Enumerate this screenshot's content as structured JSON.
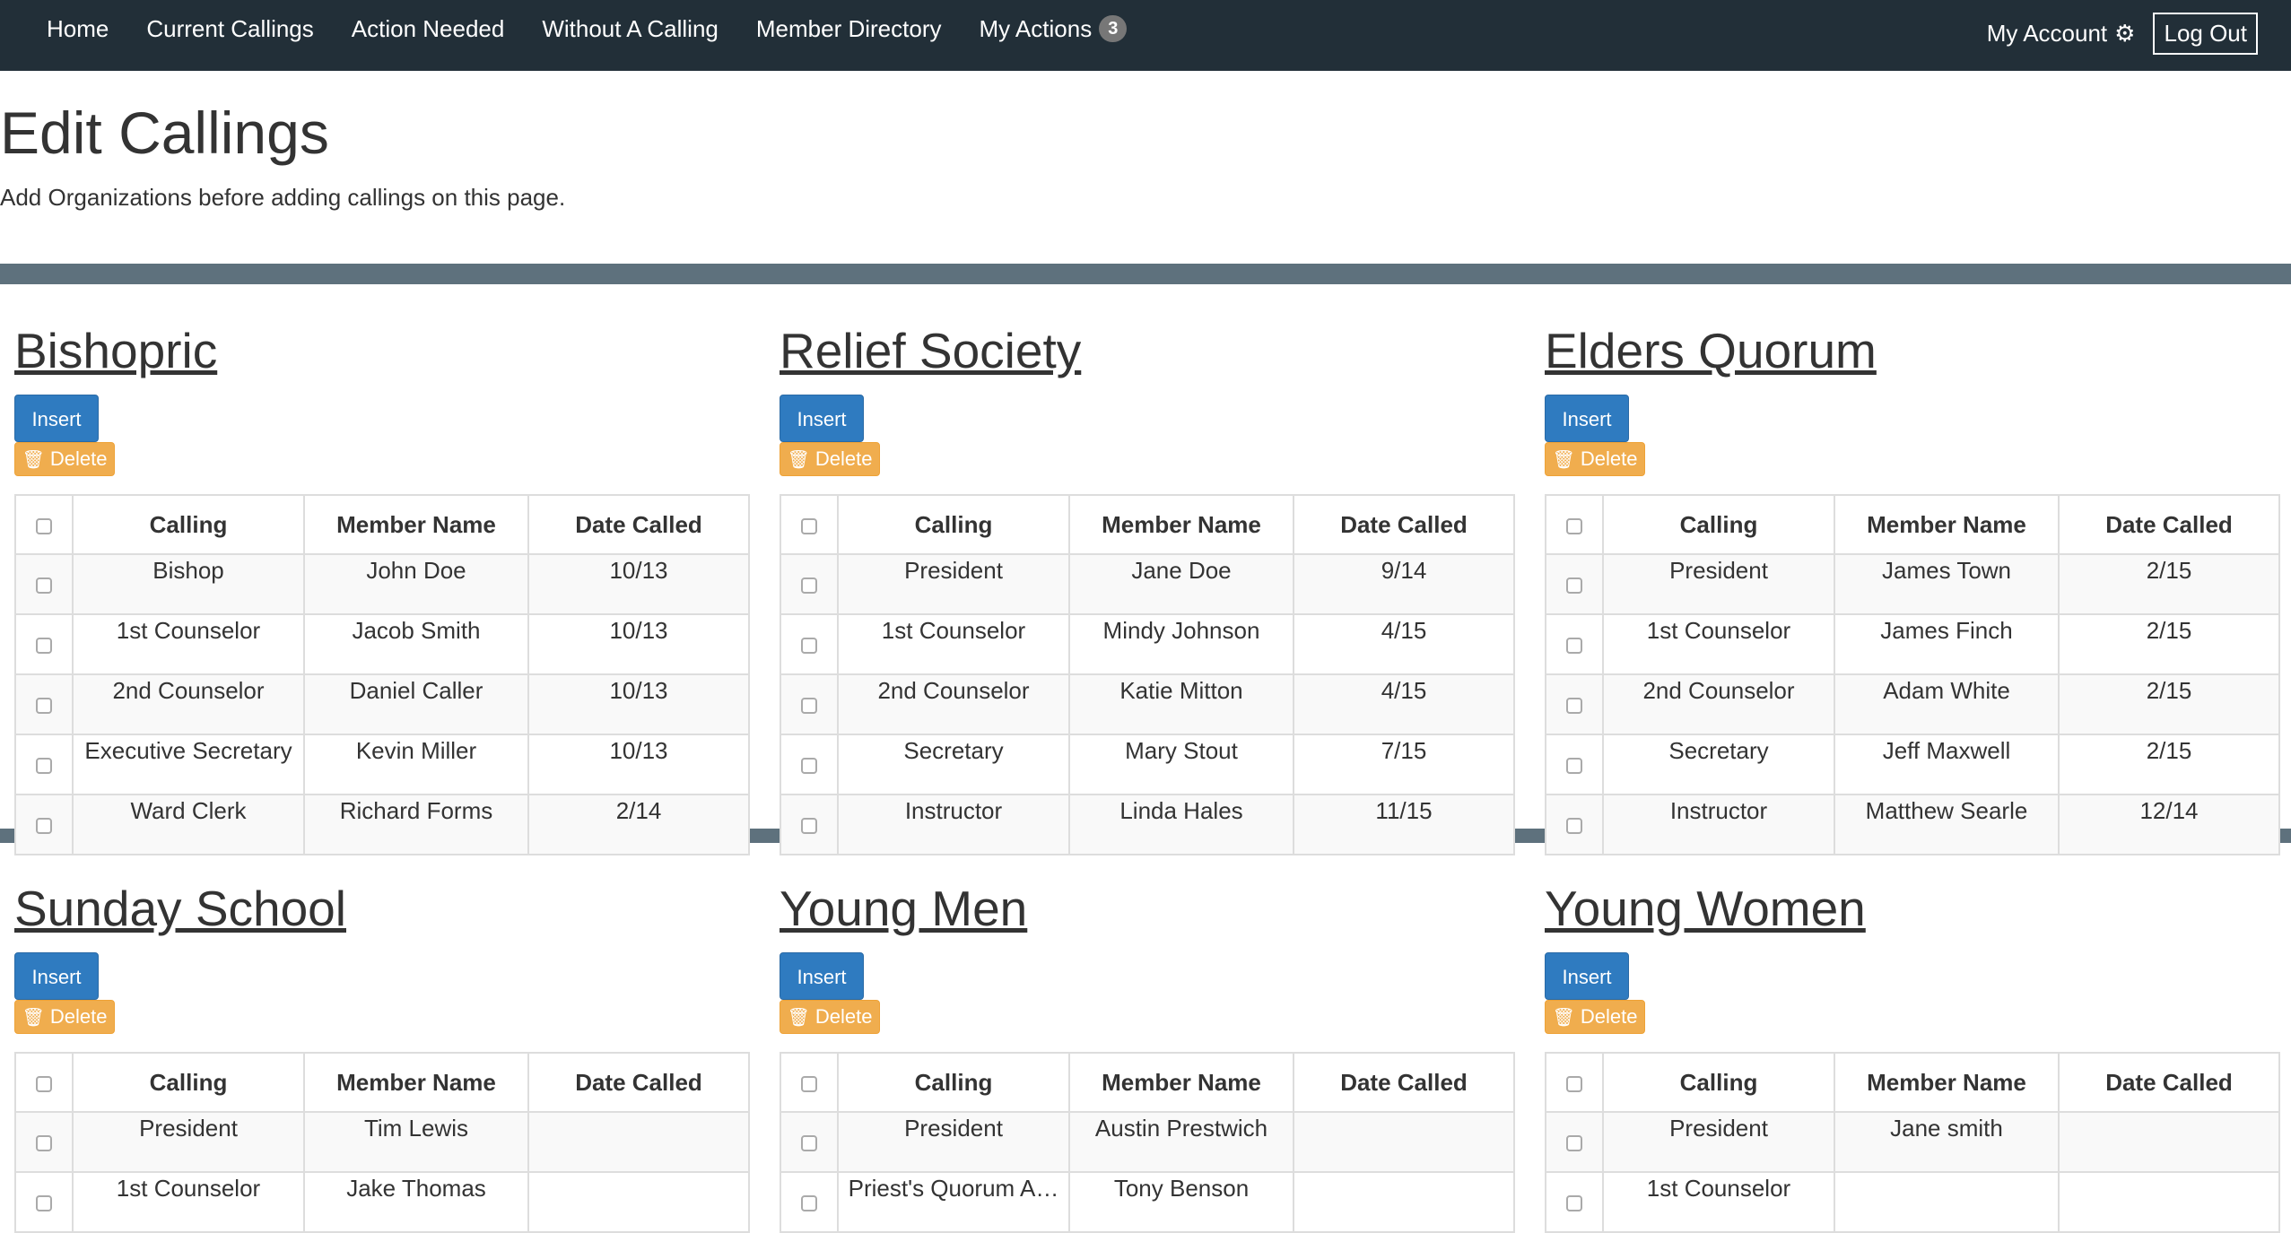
{
  "nav": {
    "links": [
      "Home",
      "Current Callings",
      "Action Needed",
      "Without A Calling",
      "Member Directory",
      "My Actions"
    ],
    "actions_badge": "3",
    "account": "My Account",
    "logout": "Log Out"
  },
  "header": {
    "title": "Edit Callings",
    "subtitle": "Add Organizations before adding callings on this page."
  },
  "buttons": {
    "insert": "Insert",
    "delete": "Delete"
  },
  "columns": [
    "Calling",
    "Member Name",
    "Date Called"
  ],
  "organizations": [
    {
      "name": "Bishopric",
      "rows": [
        [
          "Bishop",
          "John Doe",
          "10/13"
        ],
        [
          "1st Counselor",
          "Jacob Smith",
          "10/13"
        ],
        [
          "2nd Counselor",
          "Daniel Caller",
          "10/13"
        ],
        [
          "Executive Secretary",
          "Kevin Miller",
          "10/13"
        ],
        [
          "Ward Clerk",
          "Richard Forms",
          "2/14"
        ]
      ]
    },
    {
      "name": "Relief Society",
      "rows": [
        [
          "President",
          "Jane Doe",
          "9/14"
        ],
        [
          "1st Counselor",
          "Mindy Johnson",
          "4/15"
        ],
        [
          "2nd Counselor",
          "Katie Mitton",
          "4/15"
        ],
        [
          "Secretary",
          "Mary Stout",
          "7/15"
        ],
        [
          "Instructor",
          "Linda Hales",
          "11/15"
        ]
      ]
    },
    {
      "name": "Elders Quorum",
      "rows": [
        [
          "President",
          "James Town",
          "2/15"
        ],
        [
          "1st Counselor",
          "James Finch",
          "2/15"
        ],
        [
          "2nd Counselor",
          "Adam White",
          "2/15"
        ],
        [
          "Secretary",
          "Jeff Maxwell",
          "2/15"
        ],
        [
          "Instructor",
          "Matthew Searle",
          "12/14"
        ]
      ]
    },
    {
      "name": "Sunday School",
      "rows": [
        [
          "President",
          "Tim Lewis",
          ""
        ],
        [
          "1st Counselor",
          "Jake Thomas",
          ""
        ]
      ]
    },
    {
      "name": "Young Men",
      "rows": [
        [
          "President",
          "Austin Prestwich",
          ""
        ],
        [
          "Priest's Quorum A…",
          "Tony Benson",
          ""
        ]
      ]
    },
    {
      "name": "Young Women",
      "rows": [
        [
          "President",
          "Jane smith",
          ""
        ],
        [
          "1st Counselor",
          "",
          ""
        ]
      ]
    }
  ]
}
